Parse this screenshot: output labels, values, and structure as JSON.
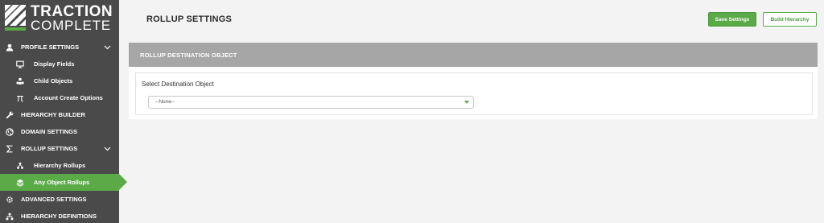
{
  "brand": {
    "line1": "TRACTION",
    "line2": "COMPLETE"
  },
  "sidebar": {
    "items": [
      {
        "label": "PROFILE SETTINGS",
        "icon": "user-icon",
        "level": "top",
        "expanded": true
      },
      {
        "label": "Display Fields",
        "icon": "monitor-icon",
        "level": "sub"
      },
      {
        "label": "Child Objects",
        "icon": "sitemap-icon",
        "level": "sub"
      },
      {
        "label": "Account Create Options",
        "icon": "pi-icon",
        "level": "sub"
      },
      {
        "label": "HIERARCHY BUILDER",
        "icon": "wrench-icon",
        "level": "top"
      },
      {
        "label": "DOMAIN SETTINGS",
        "icon": "globe-icon",
        "level": "top"
      },
      {
        "label": "ROLLUP SETTINGS",
        "icon": "sigma-icon",
        "level": "top",
        "expanded": true
      },
      {
        "label": "Hierarchy Rollups",
        "icon": "tree-icon",
        "level": "sub"
      },
      {
        "label": "Any Object Rollups",
        "icon": "layers-icon",
        "level": "sub",
        "active": true
      },
      {
        "label": "ADVANCED SETTINGS",
        "icon": "gears-icon",
        "level": "top"
      },
      {
        "label": "HIERARCHY DEFINITIONS",
        "icon": "org-chart-icon",
        "level": "top"
      }
    ]
  },
  "header": {
    "title": "ROLLUP SETTINGS",
    "save_label": "Save Settings",
    "build_label": "Build Hierarchy"
  },
  "panel": {
    "title": "ROLLUP DESTINATION OBJECT",
    "field_label": "Select Destination Object",
    "select_value": "--None--"
  },
  "colors": {
    "accent": "#5aaa48",
    "sidebar_bg": "#4a4a4a",
    "panel_header": "#a6a6a6",
    "page_bg": "#f3f3f3"
  }
}
